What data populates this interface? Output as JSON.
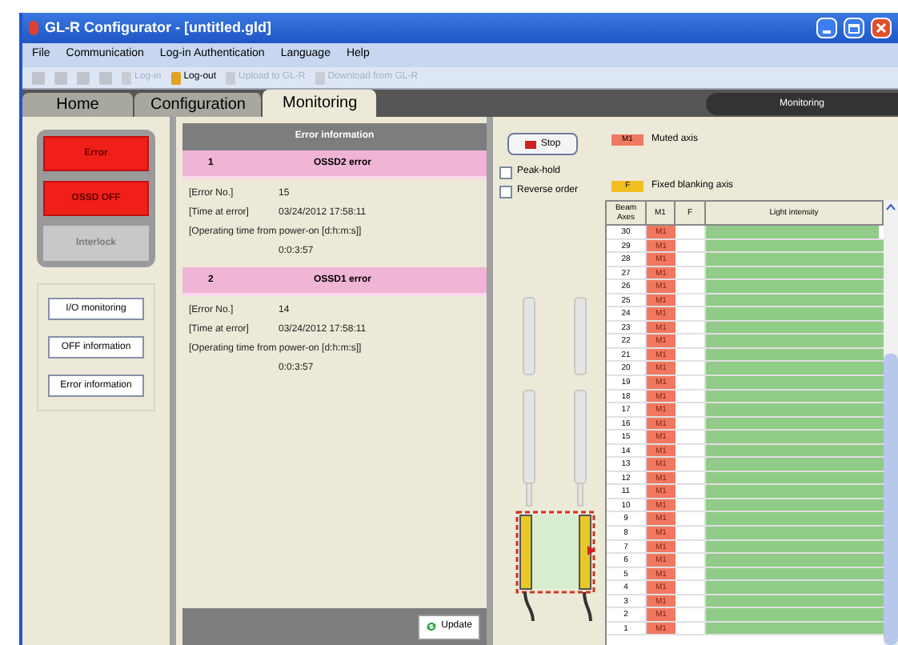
{
  "window": {
    "title": "GL-R Configurator - [untitled.gld]"
  },
  "menu": [
    "File",
    "Communication",
    "Log-in Authentication",
    "Language",
    "Help"
  ],
  "toolbar": [
    {
      "label": "Log-in",
      "disabled": true
    },
    {
      "label": "Log-out",
      "disabled": false
    },
    {
      "label": "Upload to GL-R",
      "disabled": true
    },
    {
      "label": "Download from GL-R",
      "disabled": true
    }
  ],
  "tabs": [
    {
      "label": "Home",
      "selected": false
    },
    {
      "label": "Configuration",
      "selected": false
    },
    {
      "label": "Monitoring",
      "selected": true
    }
  ],
  "mode_label": "Monitoring",
  "indicators": [
    {
      "label": "Error",
      "on": true
    },
    {
      "label": "OSSD OFF",
      "on": true
    },
    {
      "label": "Interlock",
      "on": false
    }
  ],
  "side_buttons": [
    "I/O monitoring",
    "OFF information",
    "Error information"
  ],
  "error_panel": {
    "title": "Error information",
    "update_button": "Update",
    "errors": [
      {
        "index": "1",
        "name": "OSSD2 error",
        "no_label": "[Error No.]",
        "no": "15",
        "time_label": "[Time at error]",
        "time": "03/24/2012 17:58:11",
        "op_label": "[Operating time from power-on [d:h:m:s]]",
        "op_time": "0:0:3:57"
      },
      {
        "index": "2",
        "name": "OSSD1 error",
        "no_label": "[Error No.]",
        "no": "14",
        "time_label": "[Time at error]",
        "time": "03/24/2012 17:58:11",
        "op_label": "[Operating time from power-on [d:h:m:s]]",
        "op_time": "0:0:3:57"
      }
    ]
  },
  "stop_button": "Stop",
  "options": [
    {
      "label": "Peak-hold",
      "checked": false
    },
    {
      "label": "Reverse order",
      "checked": false
    }
  ],
  "legend": [
    {
      "swatch": "M1",
      "label": "Muted axis",
      "color": "#f07860"
    },
    {
      "swatch": "F",
      "label": "Fixed blanking axis",
      "color": "#f0c020"
    }
  ],
  "table": {
    "columns": [
      "Beam Axes",
      "M1",
      "F",
      "Light intensity"
    ],
    "rows": [
      {
        "axis": "30",
        "m1": "M1",
        "level": 0.97
      },
      {
        "axis": "29",
        "m1": "M1",
        "level": 1
      },
      {
        "axis": "28",
        "m1": "M1",
        "level": 1
      },
      {
        "axis": "27",
        "m1": "M1",
        "level": 1
      },
      {
        "axis": "26",
        "m1": "M1",
        "level": 1
      },
      {
        "axis": "25",
        "m1": "M1",
        "level": 1
      },
      {
        "axis": "24",
        "m1": "M1",
        "level": 1
      },
      {
        "axis": "23",
        "m1": "M1",
        "level": 1
      },
      {
        "axis": "22",
        "m1": "M1",
        "level": 1
      },
      {
        "axis": "21",
        "m1": "M1",
        "level": 1
      },
      {
        "axis": "20",
        "m1": "M1",
        "level": 1
      },
      {
        "axis": "19",
        "m1": "M1",
        "level": 1
      },
      {
        "axis": "18",
        "m1": "M1",
        "level": 1
      },
      {
        "axis": "17",
        "m1": "M1",
        "level": 1
      },
      {
        "axis": "16",
        "m1": "M1",
        "level": 1
      },
      {
        "axis": "15",
        "m1": "M1",
        "level": 1
      },
      {
        "axis": "14",
        "m1": "M1",
        "level": 1
      },
      {
        "axis": "13",
        "m1": "M1",
        "level": 1
      },
      {
        "axis": "12",
        "m1": "M1",
        "level": 1
      },
      {
        "axis": "11",
        "m1": "M1",
        "level": 1
      },
      {
        "axis": "10",
        "m1": "M1",
        "level": 1
      },
      {
        "axis": "9",
        "m1": "M1",
        "level": 1
      },
      {
        "axis": "8",
        "m1": "M1",
        "level": 1
      },
      {
        "axis": "7",
        "m1": "M1",
        "level": 1
      },
      {
        "axis": "6",
        "m1": "M1",
        "level": 1
      },
      {
        "axis": "5",
        "m1": "M1",
        "level": 1
      },
      {
        "axis": "4",
        "m1": "M1",
        "level": 1
      },
      {
        "axis": "3",
        "m1": "M1",
        "level": 1
      },
      {
        "axis": "2",
        "m1": "M1",
        "level": 1
      },
      {
        "axis": "1",
        "m1": "M1",
        "level": 1
      }
    ]
  }
}
